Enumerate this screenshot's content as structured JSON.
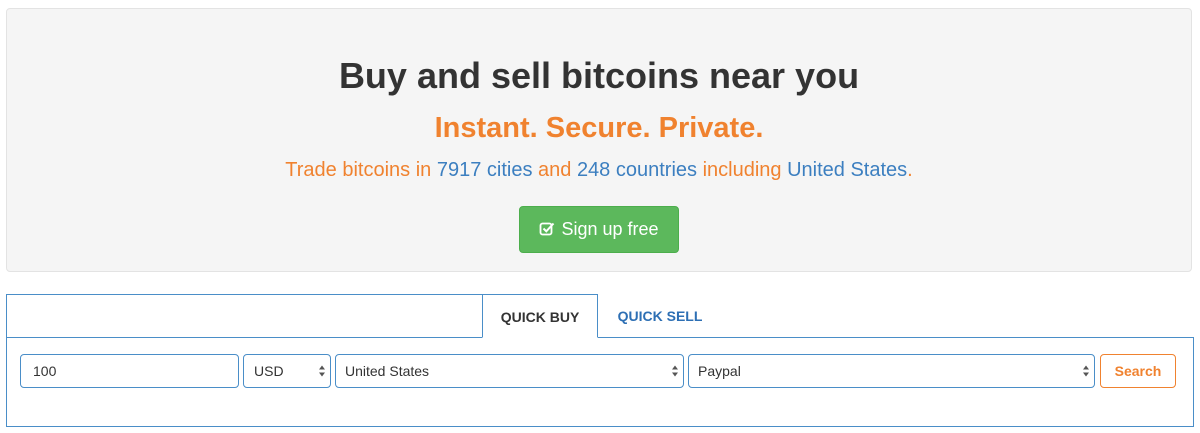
{
  "hero": {
    "title": "Buy and sell bitcoins near you",
    "tagline": "Instant. Secure. Private.",
    "sub": {
      "part1": "Trade bitcoins in ",
      "cities": "7917 cities",
      "part2": " and ",
      "countries": "248 countries",
      "part3": " including ",
      "location": "United States",
      "part4": "."
    },
    "signup_label": "Sign up free",
    "signup_icon": "check-square-icon"
  },
  "quick_panel": {
    "tabs": [
      {
        "label": "QUICK BUY",
        "active": true
      },
      {
        "label": "QUICK SELL",
        "active": false
      }
    ],
    "amount": "100",
    "currency": "USD",
    "country": "United States",
    "payment_method": "Paypal",
    "search_label": "Search"
  },
  "colors": {
    "accent_orange": "#f0822f",
    "link_blue": "#3c7fc0",
    "success_green": "#5cb85c",
    "border_blue": "#4a8ec8"
  }
}
